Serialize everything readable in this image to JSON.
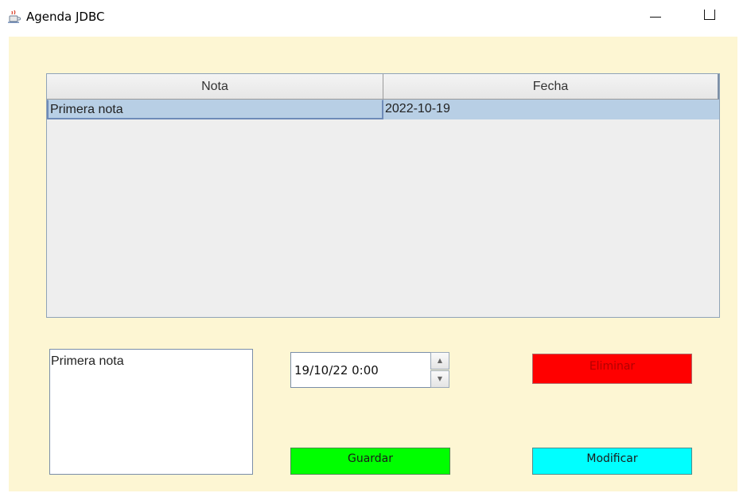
{
  "window": {
    "title": "Agenda JDBC",
    "icon": "java-cup-icon"
  },
  "table": {
    "columns": [
      "Nota",
      "Fecha"
    ],
    "rows": [
      {
        "nota": "Primera nota",
        "fecha": "2022-10-19"
      }
    ],
    "selected_row": 0
  },
  "form": {
    "nota_text": "Primera nota",
    "fecha_value": "19/10/22 0:00",
    "spin_up_icon": "arrow-up-icon",
    "spin_down_icon": "arrow-down-icon"
  },
  "buttons": {
    "eliminar": "Eliminar",
    "guardar": "Guardar",
    "modificar": "Modificar"
  },
  "colors": {
    "panel_background": "#fdf6d3",
    "selection": "#b8cfe5",
    "eliminar": "#ff0000",
    "guardar": "#00ff00",
    "modificar": "#00ffff"
  }
}
